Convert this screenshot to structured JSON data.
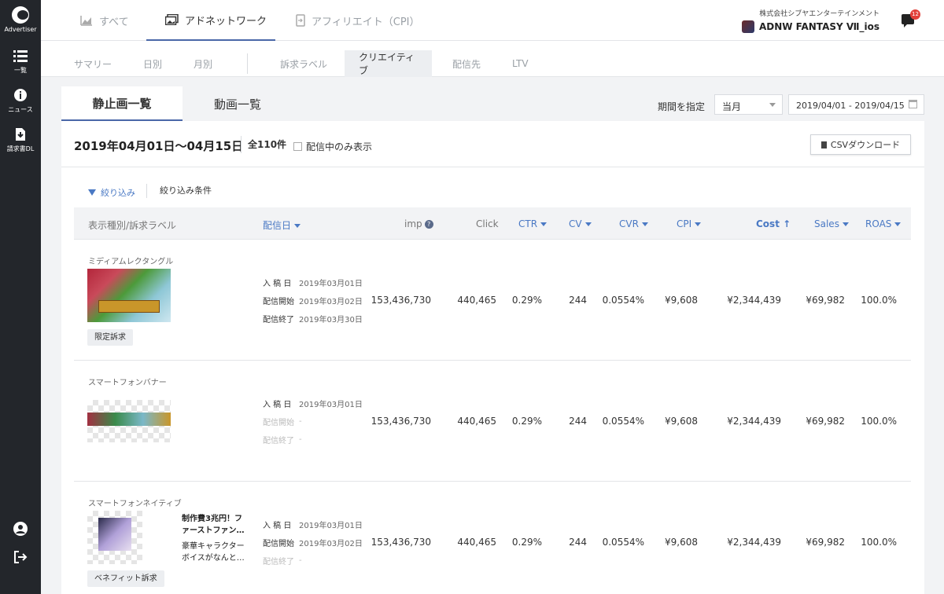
{
  "sidebar": {
    "brand": "Advertiser",
    "items": [
      {
        "label": "一覧",
        "icon": "list-icon"
      },
      {
        "label": "ニュース",
        "icon": "info-icon"
      },
      {
        "label": "請求書DL",
        "icon": "download-doc-icon"
      }
    ],
    "bottom": [
      {
        "icon": "user-icon"
      },
      {
        "icon": "logout-icon"
      }
    ]
  },
  "topbar": {
    "tabs": [
      {
        "label": "すべて",
        "icon": "area-chart-icon",
        "active": false
      },
      {
        "label": "アドネットワーク",
        "icon": "images-icon",
        "active": true
      },
      {
        "label": "アフィリエイト（CPI）",
        "icon": "phone-icon",
        "active": false
      }
    ],
    "company": "株式会社シブヤエンターテインメント",
    "app_name": "ADNW FANTASY Ⅶ_ios",
    "notification_count": "12"
  },
  "subnav": {
    "tabs": [
      "サマリー",
      "日別",
      "月別",
      "訴求ラベル",
      "クリエイティブ",
      "配信先",
      "LTV"
    ],
    "active": "クリエイティブ"
  },
  "content_tabs": [
    "静止画一覧",
    "動画一覧"
  ],
  "period": {
    "label": "期間を指定",
    "select_value": "当月",
    "date_range": "2019/04/01 - 2019/04/15"
  },
  "panel": {
    "title": "2019年04月01日〜04月15日",
    "count": "全110件",
    "only_live_label": "配信中のみ表示",
    "csv_label": "CSVダウンロード",
    "filter_label": "絞り込み",
    "filter_conditions": "絞り込み条件"
  },
  "table": {
    "headers": {
      "type": "表示種別/訴求ラベル",
      "date": "配信日",
      "imp": "imp",
      "click": "Click",
      "ctr": "CTR",
      "cv": "CV",
      "cvr": "CVR",
      "cpi": "CPI",
      "cost": "Cost",
      "sales": "Sales",
      "roas": "ROAS"
    },
    "rows": [
      {
        "type": "ミディアムレクタングル",
        "tag": "限定訴求",
        "date_keys": [
          "入 稿 日",
          "配信開始",
          "配信終了"
        ],
        "date_vals": [
          "2019年03月01日",
          "2019年03月02日",
          "2019年03月30日"
        ],
        "imp": "153,436,730",
        "click": "440,465",
        "ctr": "0.29%",
        "cv": "244",
        "cvr": "0.0554%",
        "cpi": "¥9,608",
        "cost": "¥2,344,439",
        "sales": "¥69,982",
        "roas": "100.0%"
      },
      {
        "type": "スマートフォンバナー",
        "date_keys": [
          "入 稿 日",
          "配信開始",
          "配信終了"
        ],
        "date_vals": [
          "2019年03月01日",
          "-",
          "-"
        ],
        "imp": "153,436,730",
        "click": "440,465",
        "ctr": "0.29%",
        "cv": "244",
        "cvr": "0.0554%",
        "cpi": "¥9,608",
        "cost": "¥2,344,439",
        "sales": "¥69,982",
        "roas": "100.0%"
      },
      {
        "type": "スマートフォンネイティブ",
        "tag": "ベネフィット訴求",
        "native_title": "制作費3兆円！ファーストファン…",
        "native_desc": "豪華キャラクターボイスがなんと…",
        "date_keys": [
          "入 稿 日",
          "配信開始",
          "配信終了"
        ],
        "date_vals": [
          "2019年03月01日",
          "2019年03月02日",
          "-"
        ],
        "imp": "153,436,730",
        "click": "440,465",
        "ctr": "0.29%",
        "cv": "244",
        "cvr": "0.0554%",
        "cpi": "¥9,608",
        "cost": "¥2,344,439",
        "sales": "¥69,982",
        "roas": "100.0%"
      }
    ]
  }
}
